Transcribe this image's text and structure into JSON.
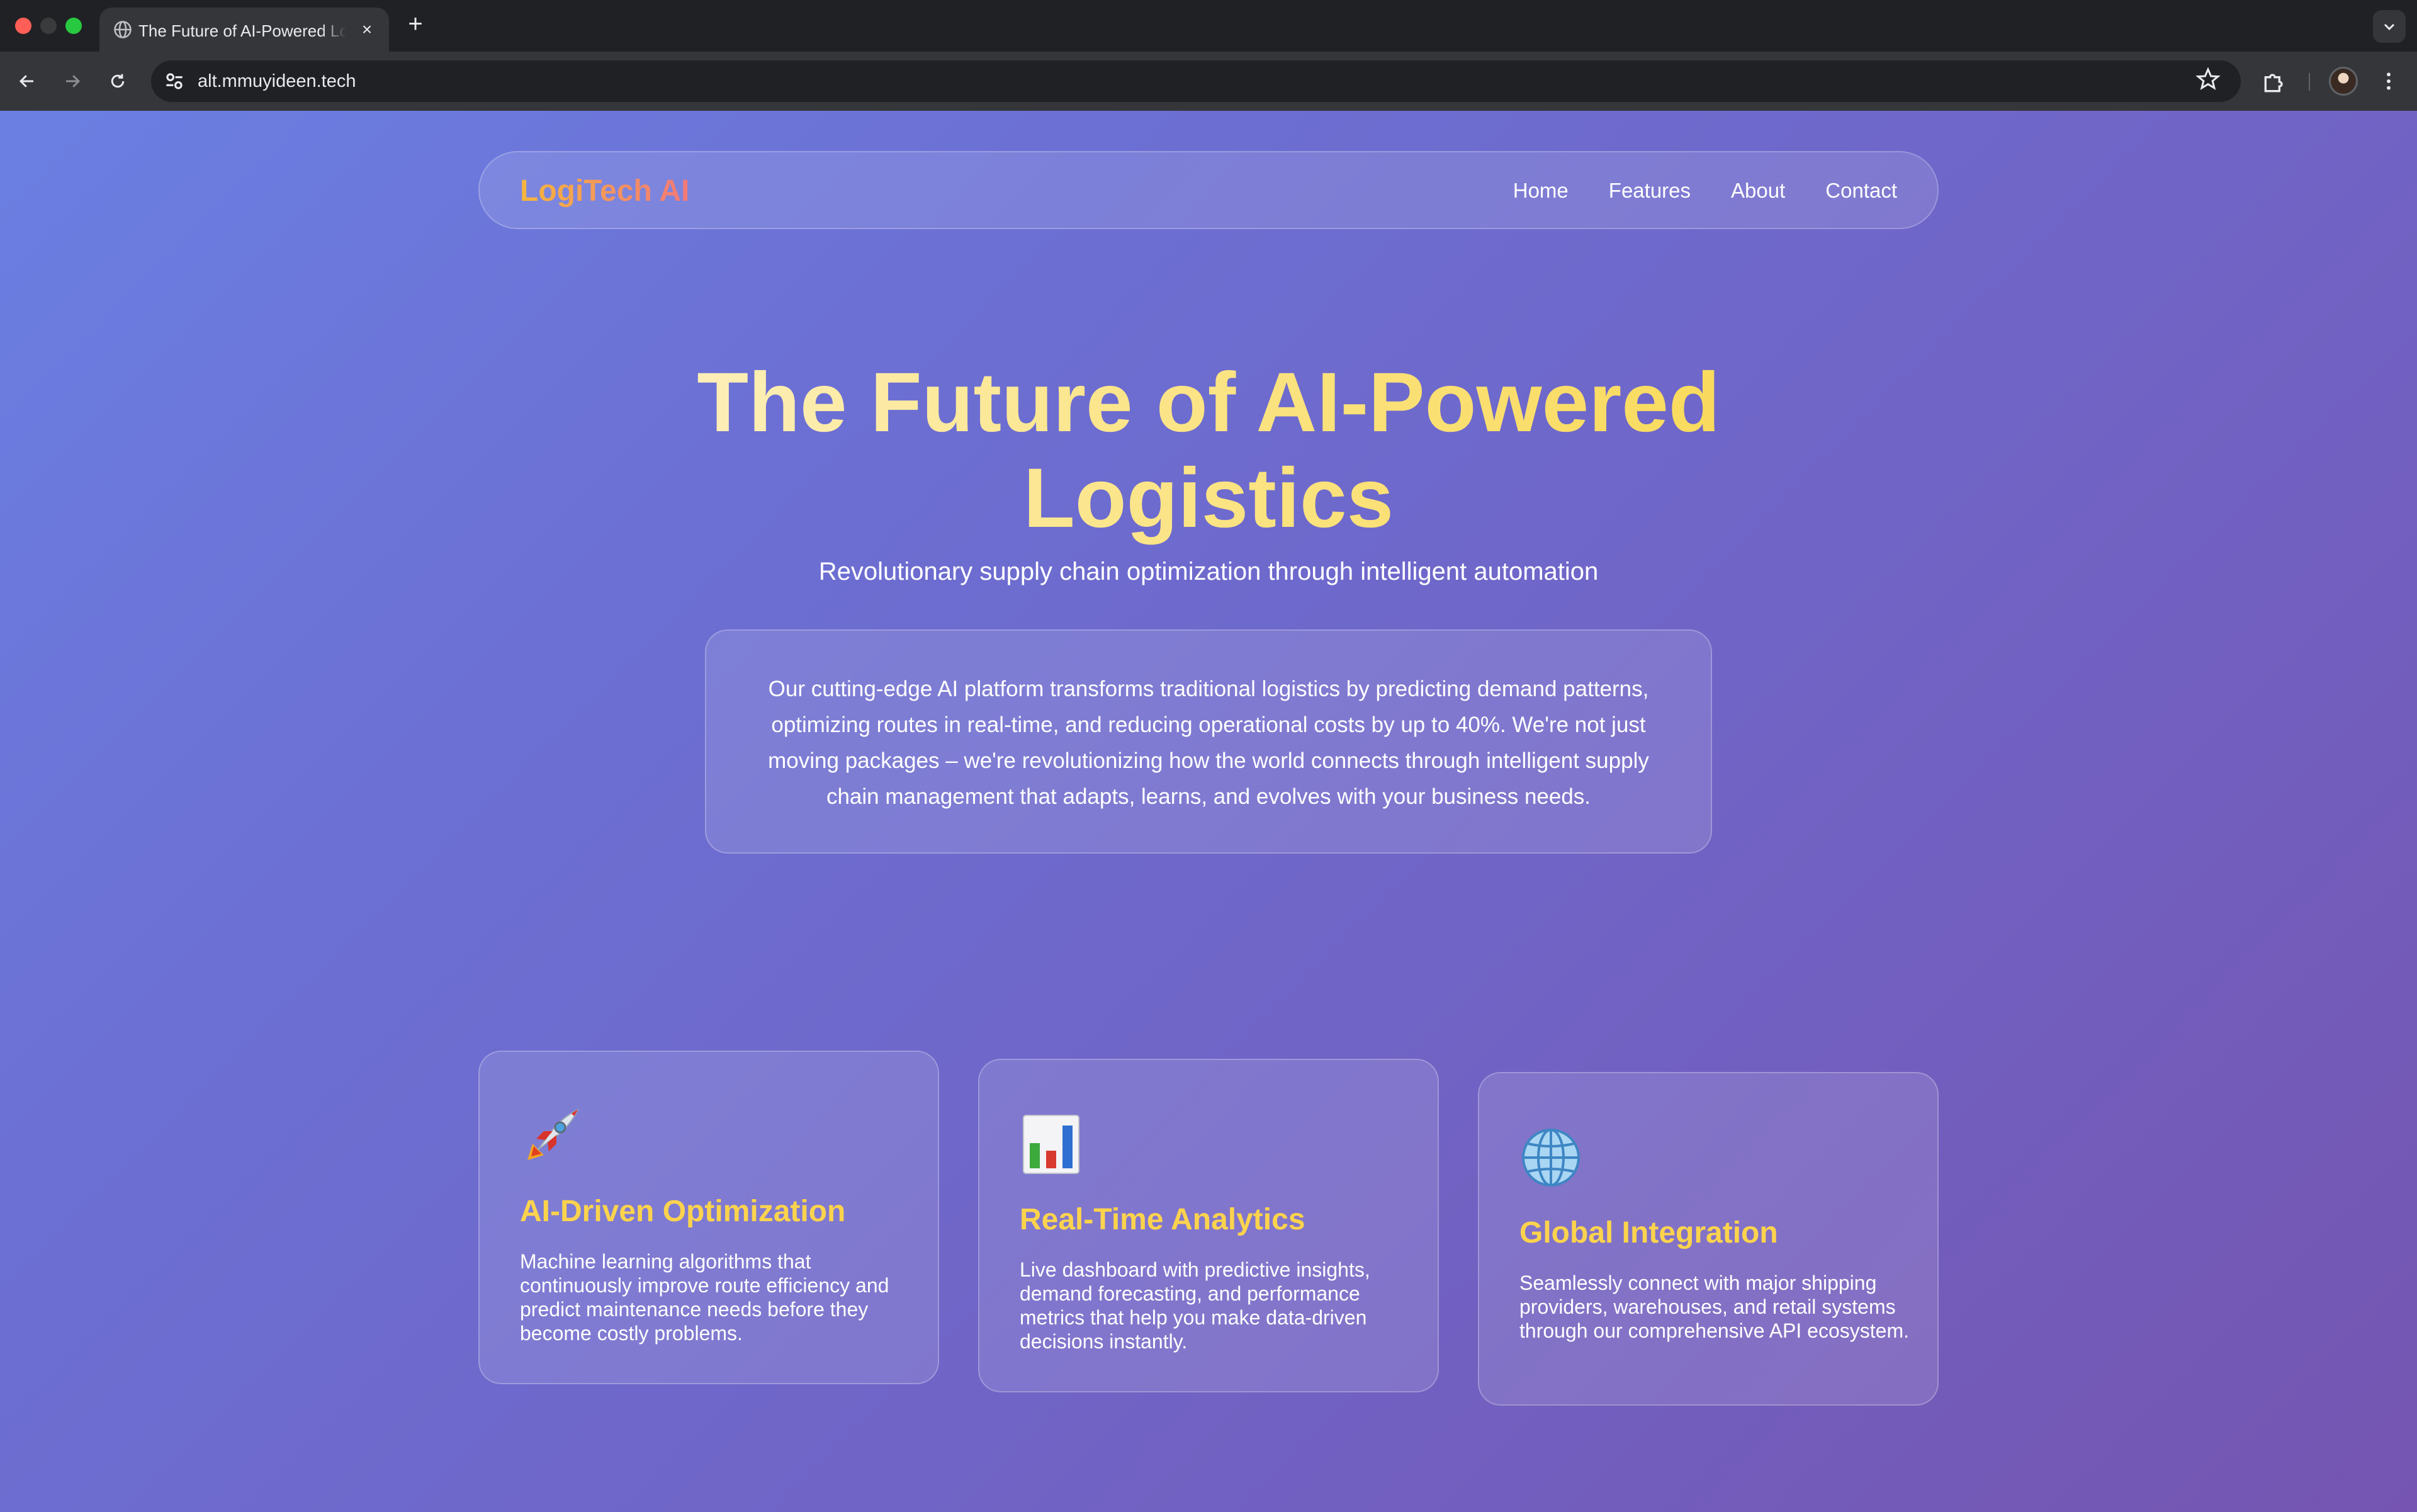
{
  "browser": {
    "tab_title": "The Future of AI-Powered Logistics",
    "tab_close": "×",
    "new_tab": "+",
    "url": "alt.mmuyideen.tech"
  },
  "site": {
    "logo": "LogiTech AI",
    "nav": [
      "Home",
      "Features",
      "About",
      "Contact"
    ]
  },
  "hero": {
    "title_line1": "The Future of AI-Powered",
    "title_line2": "Logistics",
    "subtitle": "Revolutionary supply chain optimization through intelligent automation",
    "intro": "Our cutting-edge AI platform transforms traditional logistics by predicting demand patterns, optimizing routes in real-time, and reducing operational costs by up to 40%. We're not just moving packages – we're revolutionizing how the world connects through intelligent supply chain management that adapts, learns, and evolves with your business needs."
  },
  "features": [
    {
      "icon": "rocket-icon",
      "title": "AI-Driven Optimization",
      "text": "Machine learning algorithms that continuously improve route efficiency and predict maintenance needs before they become costly problems."
    },
    {
      "icon": "bar-chart-icon",
      "title": "Real-Time Analytics",
      "text": "Live dashboard with predictive insights, demand forecasting, and performance metrics that help you make data-driven decisions instantly."
    },
    {
      "icon": "globe-icon",
      "title": "Global Integration",
      "text": "Seamlessly connect with major shipping providers, warehouses, and retail systems through our comprehensive API ecosystem."
    }
  ],
  "colors": {
    "page_gradient_start": "#6b7fe2",
    "page_gradient_end": "#7555b1",
    "logo_gradient": [
      "#f6b73c",
      "#f2787a"
    ],
    "feature_title": "#fcd34d",
    "hero_title_gradient": [
      "#fdf4d0",
      "#f8d64a"
    ]
  }
}
